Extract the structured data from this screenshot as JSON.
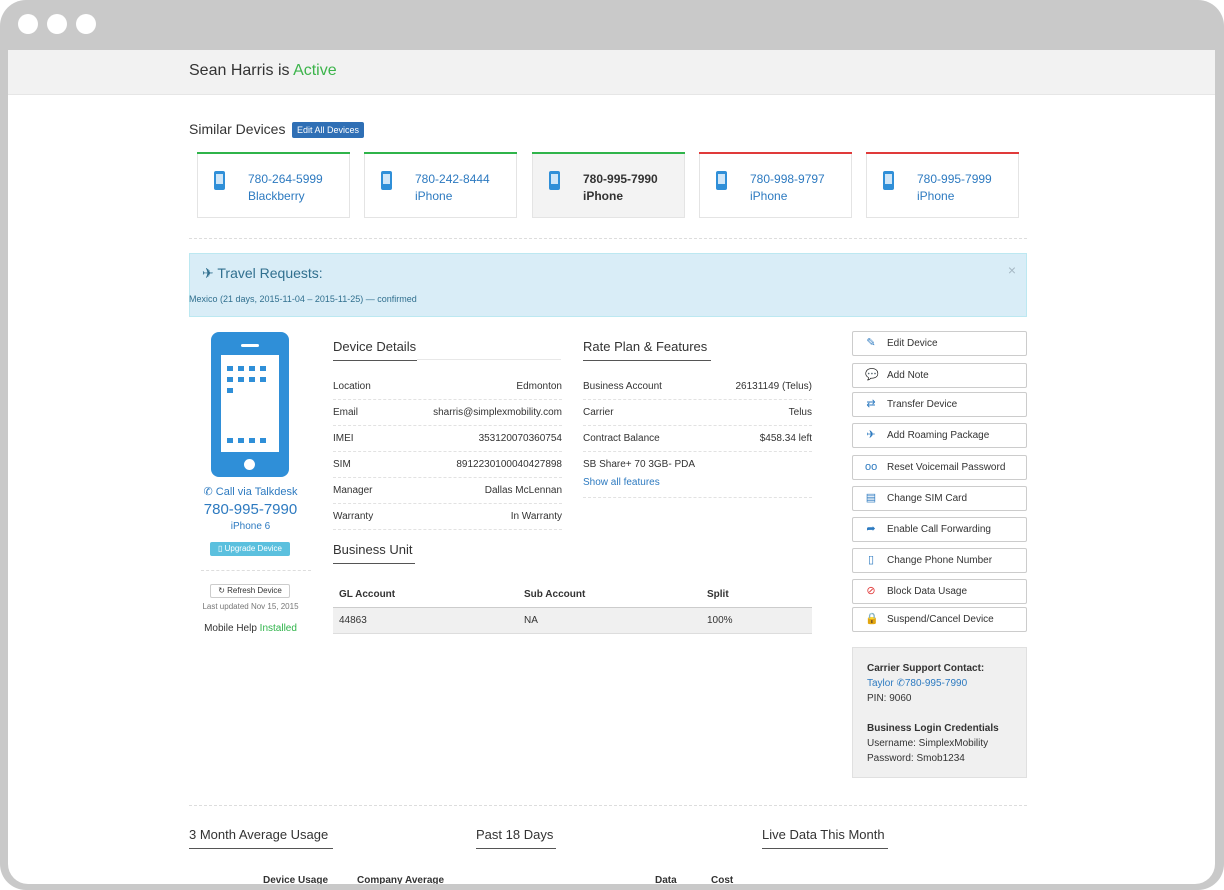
{
  "header": {
    "name": "Sean Harris",
    "is": "is",
    "status": "Active"
  },
  "similar": {
    "title": "Similar Devices",
    "edit_all_label": "Edit All Devices",
    "devices": [
      {
        "number": "780-264-5999",
        "type": "Blackberry",
        "bar_color": "#2fb44a"
      },
      {
        "number": "780-242-8444",
        "type": "iPhone",
        "bar_color": "#2fb44a"
      },
      {
        "number": "780-995-7990",
        "type": "iPhone",
        "bar_color": "#2fb44a"
      },
      {
        "number": "780-998-9797",
        "type": "iPhone",
        "bar_color": "#e03a3a"
      },
      {
        "number": "780-995-7999",
        "type": "iPhone",
        "bar_color": "#e03a3a"
      }
    ]
  },
  "alert": {
    "title": "Travel Requests:",
    "text": "Mexico (21 days, 2015-11-04 – 2015-11-25) — confirmed",
    "close": "×"
  },
  "device": {
    "call_label": "Call via Talkdesk",
    "number": "780-995-7990",
    "model": "iPhone 6",
    "upgrade_label": "Upgrade Device",
    "refresh_label": "Refresh Device",
    "last_updated": "Last updated Nov 15, 2015",
    "mobile_help_label": "Mobile Help",
    "mobile_help_status": "Installed"
  },
  "details": {
    "title": "Device Details",
    "rows": [
      {
        "k": "Location",
        "v": "Edmonton"
      },
      {
        "k": "Email",
        "v": "sharris@simplexmobility.com"
      },
      {
        "k": "IMEI",
        "v": "353120070360754"
      },
      {
        "k": "SIM",
        "v": "8912230100040427898"
      },
      {
        "k": "Manager",
        "v": "Dallas McLennan"
      },
      {
        "k": "Warranty",
        "v": "In Warranty"
      }
    ]
  },
  "rate": {
    "title": "Rate Plan & Features",
    "rows": [
      {
        "k": "Business Account",
        "v": "26131149 (Telus)"
      },
      {
        "k": "Carrier",
        "v": "Telus"
      },
      {
        "k": "Contract Balance",
        "v": "$458.34 left"
      }
    ],
    "plan": "SB Share+ 70 3GB- PDA",
    "show_all": "Show all features"
  },
  "business_unit": {
    "title": "Business Unit",
    "columns": [
      "GL Account",
      "Sub Account",
      "Split"
    ],
    "rows": [
      [
        "44863",
        "NA",
        "100%"
      ]
    ]
  },
  "actions": [
    {
      "label": "Edit Device",
      "icon": "pencil-icon",
      "glyph": "✎"
    },
    {
      "label": "Add Note",
      "icon": "speech-bubble-icon",
      "glyph": "💬"
    },
    {
      "label": "Transfer Device",
      "icon": "transfer-arrows-icon",
      "glyph": "⇄"
    },
    {
      "label": "Add Roaming Package",
      "icon": "airplane-icon",
      "glyph": "✈"
    },
    {
      "label": "Reset Voicemail Password",
      "icon": "voicemail-icon",
      "glyph": "oo"
    },
    {
      "label": "Change SIM Card",
      "icon": "sim-card-icon",
      "glyph": "▤"
    },
    {
      "label": "Enable Call Forwarding",
      "icon": "forward-arrow-icon",
      "glyph": "➦"
    },
    {
      "label": "Change Phone Number",
      "icon": "mobile-phone-icon",
      "glyph": "▯"
    },
    {
      "label": "Block Data Usage",
      "icon": "ban-icon",
      "glyph": "⊘"
    },
    {
      "label": "Suspend/Cancel Device",
      "icon": "lock-icon",
      "glyph": "🔒"
    }
  ],
  "support": {
    "carrier_title": "Carrier Support Contact:",
    "contact_name": "Taylor",
    "contact_phone": "780-995-7990",
    "pin": "PIN: 9060",
    "login_title": "Business Login Credentials",
    "username": "Username: SimplexMobility",
    "password": "Password: Smob1234"
  },
  "bottom": {
    "usage_title": "3 Month Average Usage",
    "past_title": "Past 18 Days",
    "live_title": "Live Data This Month",
    "col_device_usage": "Device Usage",
    "col_company_average": "Company Average",
    "col_data": "Data",
    "col_cost": "Cost"
  }
}
